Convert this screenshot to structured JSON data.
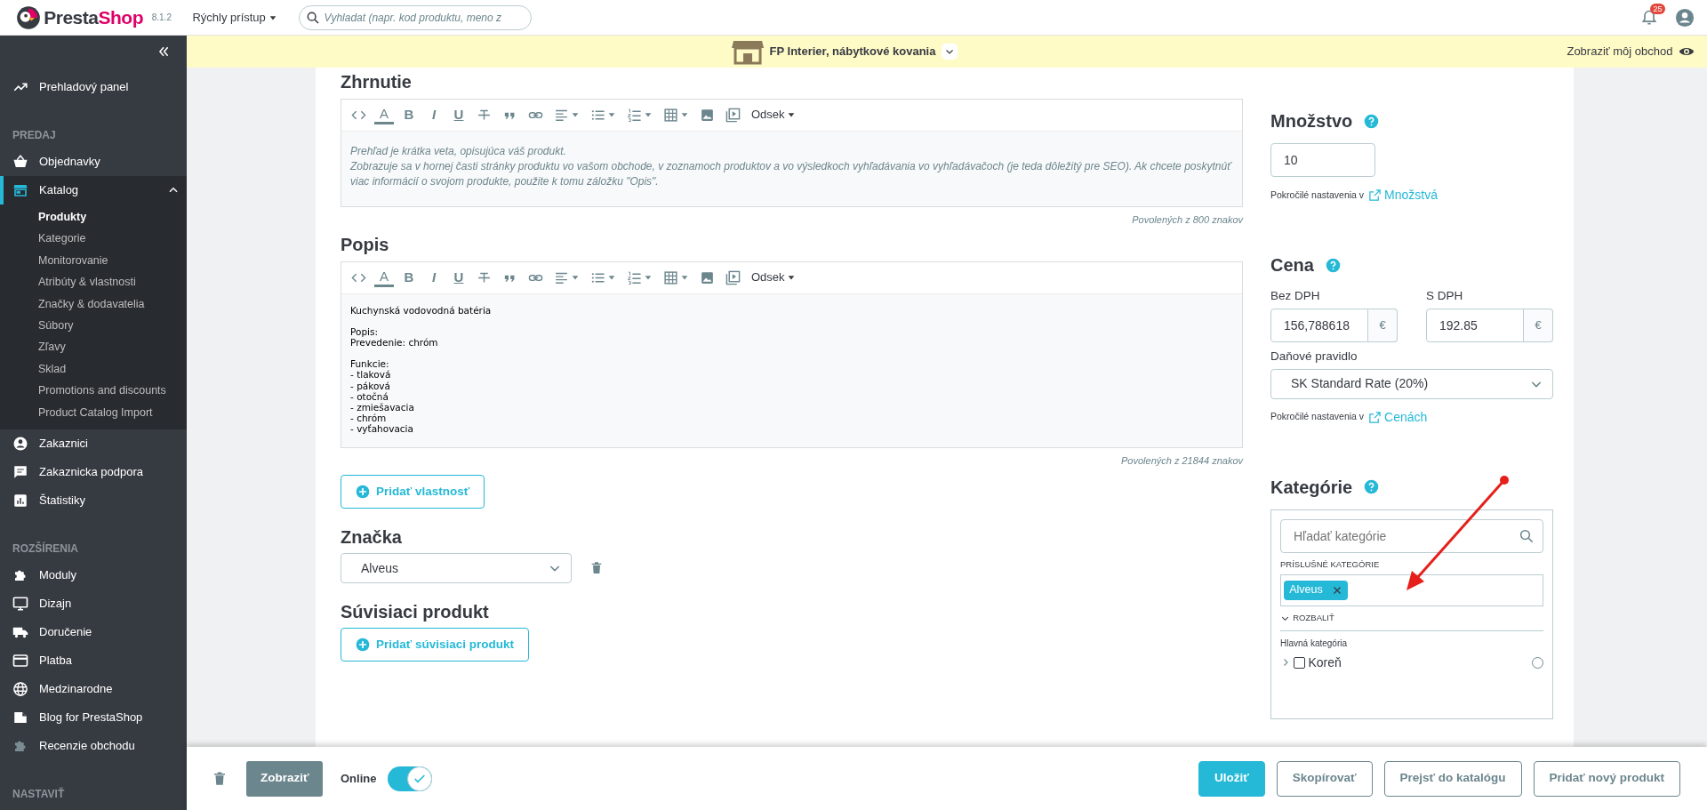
{
  "header": {
    "logo_parts": [
      "Presta",
      "Shop"
    ],
    "version": "8.1.2",
    "quick_access": "Rýchly prístup",
    "search": {
      "placeholder": "Vyhladat (napr. kod produktu, meno z"
    },
    "notification_count": "25"
  },
  "shop_bar": {
    "shop_name": "FP Interier, nábytkové kovania",
    "view_shop": "Zobraziť môj obchod"
  },
  "sidebar": {
    "sections": [
      {
        "items": [
          {
            "label": "Prehladový panel",
            "selected": false
          }
        ]
      },
      {
        "title": "PREDAJ",
        "items": [
          {
            "label": "Objednavky",
            "selected": false
          },
          {
            "label": "Katalog",
            "selected": true,
            "expanded": true,
            "children": [
              {
                "label": "Produkty",
                "selected": true
              },
              {
                "label": "Kategorie",
                "selected": false
              },
              {
                "label": "Monitorovanie",
                "selected": false
              },
              {
                "label": "Atribúty & vlastnosti",
                "selected": false
              },
              {
                "label": "Značky & dodavatelia",
                "selected": false
              },
              {
                "label": "Súbory",
                "selected": false
              },
              {
                "label": "Zľavy",
                "selected": false
              },
              {
                "label": "Sklad",
                "selected": false
              },
              {
                "label": "Promotions and discounts",
                "selected": false
              },
              {
                "label": "Product Catalog Import",
                "selected": false
              }
            ]
          },
          {
            "label": "Zakaznici",
            "selected": false
          },
          {
            "label": "Zakaznicka podpora",
            "selected": false
          },
          {
            "label": "Štatistiky",
            "selected": false
          }
        ]
      },
      {
        "title": "ROZŠÍRENIA",
        "items": [
          {
            "label": "Moduly",
            "selected": false
          },
          {
            "label": "Dizajn",
            "selected": false
          },
          {
            "label": "Doručenie",
            "selected": false
          },
          {
            "label": "Platba",
            "selected": false
          },
          {
            "label": "Medzinarodne",
            "selected": false
          },
          {
            "label": "Blog for PrestaShop",
            "selected": false
          },
          {
            "label": "Recenzie obchodu",
            "selected": false
          }
        ]
      },
      {
        "title": "NASTAVIŤ"
      }
    ]
  },
  "summary": {
    "title": "Zhrnutie",
    "toolbar": [
      {
        "kind": "code"
      },
      {
        "kind": "text_color",
        "glyph": "A"
      },
      {
        "kind": "bold",
        "glyph": "B"
      },
      {
        "kind": "italic",
        "glyph": "I"
      },
      {
        "kind": "underline",
        "glyph": "U"
      },
      {
        "kind": "strike"
      },
      {
        "kind": "quote"
      },
      {
        "kind": "link"
      },
      {
        "kind": "align"
      },
      {
        "kind": "bullets"
      },
      {
        "kind": "numbers"
      },
      {
        "kind": "table"
      },
      {
        "kind": "image"
      },
      {
        "kind": "media"
      },
      {
        "kind": "format",
        "label": "Odsek"
      }
    ],
    "placeholder_lines": [
      "Prehľad je krátka veta, opisujúca váš produkt.",
      "Zobrazuje sa v hornej časti stránky produktu vo vašom obchode, v zoznamoch produktov a vo výsledkoch vyhľadávania vo vyhľadávačoch (je teda dôležitý pre SEO). Ak chcete poskytnúť viac informácií o svojom produkte, použite k tomu záložku \"Opis\"."
    ],
    "counter": "Povolených z 800 znakov"
  },
  "description": {
    "title": "Popis",
    "toolbar": [
      {
        "kind": "code"
      },
      {
        "kind": "text_color",
        "glyph": "A"
      },
      {
        "kind": "bold",
        "glyph": "B"
      },
      {
        "kind": "italic",
        "glyph": "I"
      },
      {
        "kind": "underline",
        "glyph": "U"
      },
      {
        "kind": "strike"
      },
      {
        "kind": "quote"
      },
      {
        "kind": "link"
      },
      {
        "kind": "align"
      },
      {
        "kind": "bullets"
      },
      {
        "kind": "numbers"
      },
      {
        "kind": "table"
      },
      {
        "kind": "image"
      },
      {
        "kind": "media"
      },
      {
        "kind": "format",
        "label": "Odsek"
      }
    ],
    "paragraphs": [
      [
        "Kuchynská vodovodná batéria"
      ],
      [
        "Popis:",
        "Prevedenie: chróm"
      ],
      [
        "Funkcie:",
        "- tlaková",
        "- páková",
        "- otočná",
        "- zmiešavacia",
        "- chróm",
        "- vyťahovacia"
      ]
    ],
    "counter": "Povolených z 21844 znakov"
  },
  "add_feature_button": "Pridať vlastnosť",
  "brand": {
    "title": "Značka",
    "value": "Alveus"
  },
  "related": {
    "title": "Súvisiaci produkt",
    "button": "Pridať súvisiaci produkt"
  },
  "quantity": {
    "title": "Množstvo",
    "value": "10",
    "advanced_text": "Pokročilé nastavenia v",
    "advanced_link": "Množstvá"
  },
  "price": {
    "title": "Cena",
    "fields": [
      {
        "label": "Bez DPH",
        "value": "156,788618",
        "unit": "€"
      },
      {
        "label": "S DPH",
        "value": "192.85",
        "unit": "€"
      }
    ],
    "tax_label": "Daňové pravidlo",
    "tax_value": "SK Standard Rate (20%)",
    "advanced_text": "Pokročilé nastavenia v",
    "advanced_link": "Cenách"
  },
  "categories": {
    "title": "Kategórie",
    "search": {
      "placeholder": "Hľadať kategórie"
    },
    "assigned_label": "PRÍSLUŠNÉ KATEGÓRIE",
    "tags": [
      "Alveus"
    ],
    "expand_label": "ROZBALIŤ",
    "main_label": "Hlavná kategória",
    "tree": [
      {
        "label": "Koreň",
        "expanded": false,
        "checked": false,
        "selected": false
      }
    ]
  },
  "footer": {
    "view_button": "Zobraziť",
    "online_label": "Online",
    "online": true,
    "buttons": [
      {
        "label": "Uložiť",
        "kind": "primary"
      },
      {
        "label": "Skopírovať",
        "kind": "outline"
      },
      {
        "label": "Prejsť do katalógu",
        "kind": "outline"
      },
      {
        "label": "Pridať nový produkt",
        "kind": "outline"
      }
    ]
  }
}
